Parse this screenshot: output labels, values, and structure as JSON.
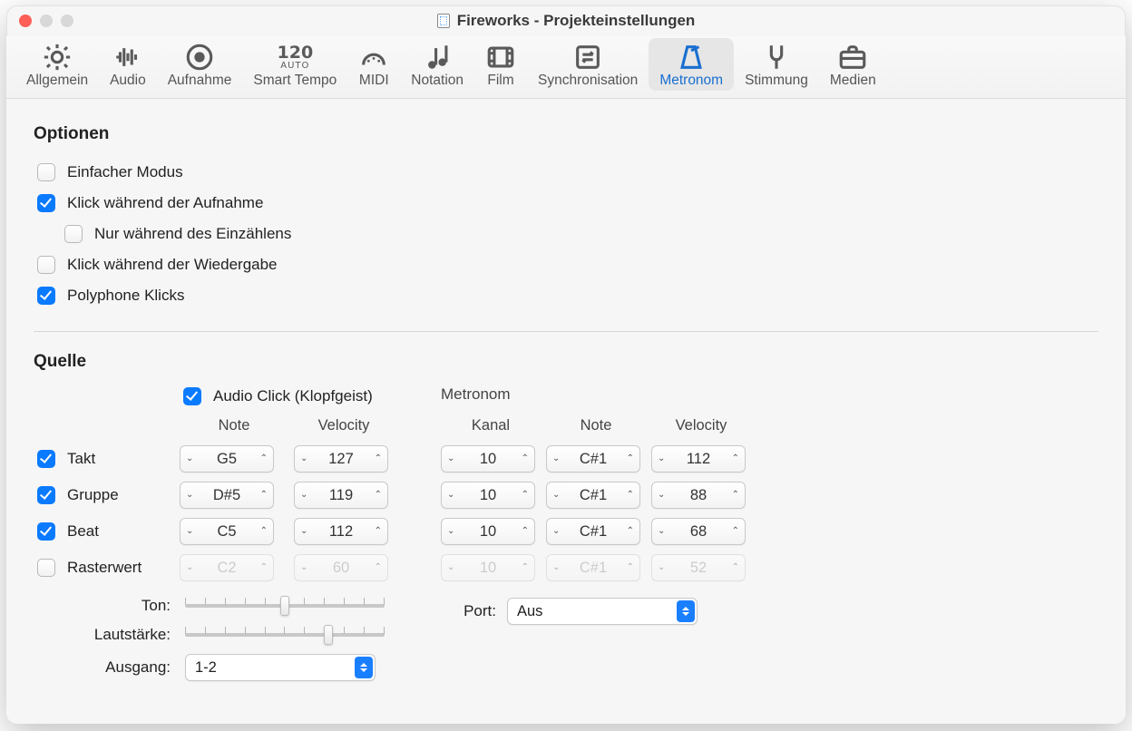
{
  "window": {
    "title": "Fireworks - Projekteinstellungen"
  },
  "toolbar": {
    "items": [
      {
        "key": "allgemein",
        "label": "Allgemein"
      },
      {
        "key": "audio",
        "label": "Audio"
      },
      {
        "key": "aufnahme",
        "label": "Aufnahme"
      },
      {
        "key": "smarttempo",
        "label": "Smart Tempo"
      },
      {
        "key": "midi",
        "label": "MIDI"
      },
      {
        "key": "notation",
        "label": "Notation"
      },
      {
        "key": "film",
        "label": "Film"
      },
      {
        "key": "sync",
        "label": "Synchronisation"
      },
      {
        "key": "metronom",
        "label": "Metronom"
      },
      {
        "key": "stimmung",
        "label": "Stimmung"
      },
      {
        "key": "medien",
        "label": "Medien"
      }
    ],
    "active": "metronom"
  },
  "optionen": {
    "heading": "Optionen",
    "einfacher_modus": {
      "label": "Einfacher Modus",
      "checked": false
    },
    "klick_aufnahme": {
      "label": "Klick während der Aufnahme",
      "checked": true
    },
    "nur_einzaehlen": {
      "label": "Nur während des Einzählens",
      "checked": false
    },
    "klick_wiedergabe": {
      "label": "Klick während der Wiedergabe",
      "checked": false
    },
    "polyphone": {
      "label": "Polyphone Klicks",
      "checked": true
    }
  },
  "quelle": {
    "heading": "Quelle",
    "audio_click": {
      "label": "Audio Click (Klopfgeist)",
      "checked": true
    },
    "midi_header": "Metronom",
    "col": {
      "note": "Note",
      "velocity": "Velocity",
      "kanal": "Kanal"
    },
    "rows": {
      "takt": {
        "label": "Takt",
        "checked": true,
        "note": "G5",
        "vel": "127",
        "kanal": "10",
        "mnote": "C#1",
        "mvel": "112"
      },
      "gruppe": {
        "label": "Gruppe",
        "checked": true,
        "note": "D#5",
        "vel": "119",
        "kanal": "10",
        "mnote": "C#1",
        "mvel": "88"
      },
      "beat": {
        "label": "Beat",
        "checked": true,
        "note": "C5",
        "vel": "112",
        "kanal": "10",
        "mnote": "C#1",
        "mvel": "68"
      },
      "raster": {
        "label": "Rasterwert",
        "checked": false,
        "note": "C2",
        "vel": "60",
        "kanal": "10",
        "mnote": "C#1",
        "mvel": "52"
      }
    },
    "ton": {
      "label": "Ton:",
      "pos": 50
    },
    "lautstaerke": {
      "label": "Lautstärke:",
      "pos": 72
    },
    "ausgang": {
      "label": "Ausgang:",
      "value": "1-2"
    },
    "port": {
      "label": "Port:",
      "value": "Aus"
    }
  }
}
